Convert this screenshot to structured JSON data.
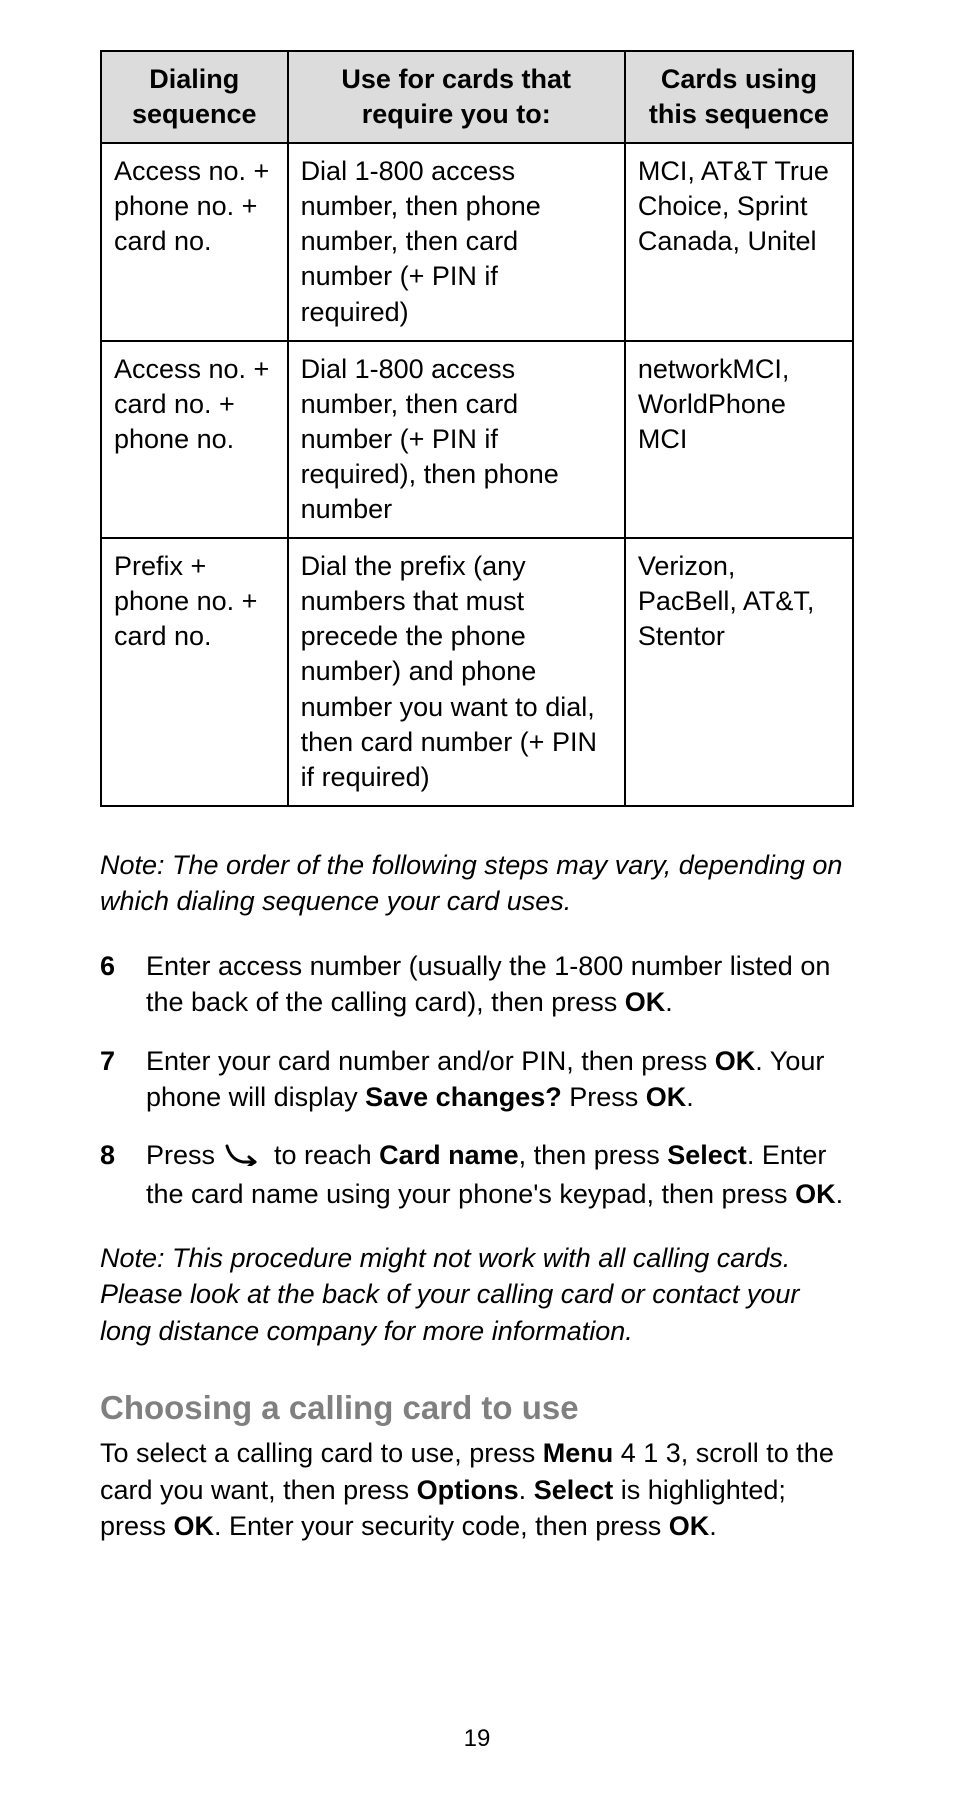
{
  "table": {
    "headers": {
      "col1_l1": "Dialing",
      "col1_l2": "sequence",
      "col2_l1": "Use for cards that",
      "col2_l2": "require you to:",
      "col3_l1": "Cards using",
      "col3_l2": "this sequence"
    },
    "rows": [
      {
        "seq": "Access no. + phone no. + card no.",
        "use": "Dial 1-800 access number, then phone number, then card number (+ PIN if required)",
        "cards": "MCI, AT&T True Choice, Sprint Canada, Unitel"
      },
      {
        "seq": "Access no. + card no. + phone no.",
        "use": "Dial 1-800 access number, then card number (+ PIN if required), then phone number",
        "cards": "networkMCI, WorldPhone MCI"
      },
      {
        "seq": "Prefix + phone no. + card no.",
        "use": "Dial the prefix (any numbers that must precede the phone number) and phone number you want to dial, then card number (+ PIN if required)",
        "cards": "Verizon, PacBell, AT&T, Stentor"
      }
    ]
  },
  "note1": "Note:  The order of the following steps may vary, depending on which dialing sequence your card uses.",
  "steps": {
    "s6_a": "Enter access number (usually the 1-800 number listed on the back of the calling card), then press ",
    "s6_ok": "OK",
    "s6_b": ".",
    "s7_a": "Enter your card number and/or PIN, then press ",
    "s7_ok1": "OK",
    "s7_b": ". Your phone will display ",
    "s7_save": "Save changes?",
    "s7_c": " Press ",
    "s7_ok2": "OK",
    "s7_d": ".",
    "s8_a": "Press ",
    "s8_b": " to reach ",
    "s8_cardname": "Card name",
    "s8_c": ", then press ",
    "s8_select": "Select",
    "s8_d": ". Enter the card name using your phone's keypad, then press ",
    "s8_ok": "OK",
    "s8_e": "."
  },
  "note2": "Note:  This procedure might not work with all calling cards. Please look at the back of your calling card or contact your long distance company for more information.",
  "section_title": "Choosing a calling card to use",
  "section_body": {
    "a": "To select a calling card to use, press ",
    "menu": "Menu",
    "b": " 4 1 3, scroll to the card you want, then press ",
    "options": "Options",
    "c": ". ",
    "select": "Select",
    "d": " is highlighted; press ",
    "ok1": "OK",
    "e": ". Enter your security code, then press ",
    "ok2": "OK",
    "f": "."
  },
  "page_number": "19"
}
